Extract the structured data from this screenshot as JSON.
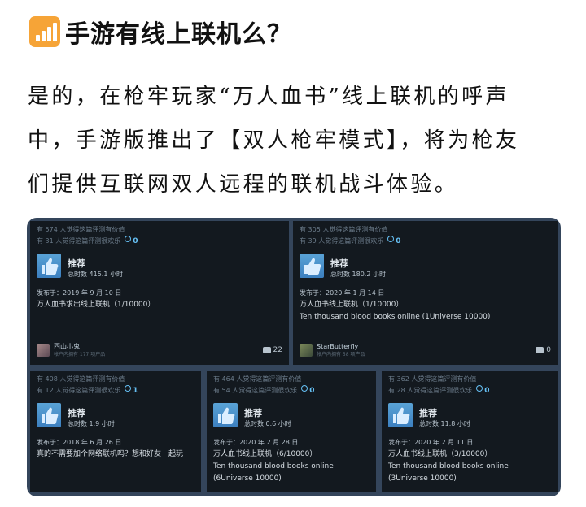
{
  "heading": "手游有线上联机么？",
  "paragraph": [
    "是的，在枪牢玩家“万人血书”线上联机的呼声",
    "中，手游版推出了【双人枪牢模式】，将为枪友",
    "们提供互联网双人远程的联机战斗体验。"
  ],
  "reviews": [
    {
      "helpful": "有 574 人觉得这篇评测有价值",
      "funny": "有 31 人觉得这篇评测很欢乐",
      "awards": "0",
      "recommend": "推荐",
      "hours": "总时数 415.1 小时",
      "posted": "发布于：2019 年 9 月 10 日",
      "body": [
        "万人血书求出线上联机（1/10000）"
      ],
      "author": "西山小鬼",
      "author_sub": "帐户内拥有 177 项产品",
      "comments": "22"
    },
    {
      "helpful": "有 305 人觉得这篇评测有价值",
      "funny": "有 39 人觉得这篇评测很欢乐",
      "awards": "0",
      "recommend": "推荐",
      "hours": "总时数 180.2 小时",
      "posted": "发布于：2020 年 1 月 14 日",
      "body": [
        "万人血书线上联机（1/10000）",
        "Ten thousand blood books online (1Universe 10000)"
      ],
      "author": "StarButterfly",
      "author_sub": "帐户内拥有 58 项产品",
      "comments": "0"
    },
    {
      "helpful": "有 408 人觉得这篇评测有价值",
      "funny": "有 12 人觉得这篇评测很欢乐",
      "awards": "1",
      "recommend": "推荐",
      "hours": "总时数 1.9 小时",
      "posted": "发布于：2018 年 6 月 26 日",
      "body": [
        "真的不需要加个网络联机吗？想和好友一起玩"
      ]
    },
    {
      "helpful": "有 464 人觉得这篇评测有价值",
      "funny": "有 54 人觉得这篇评测很欢乐",
      "awards": "0",
      "recommend": "推荐",
      "hours": "总时数 0.6 小时",
      "posted": "发布于：2020 年 2 月 28 日",
      "body": [
        "万人血书线上联机（6/10000）",
        "Ten thousand blood books online",
        "(6Universe 10000)"
      ]
    },
    {
      "helpful": "有 362 人觉得这篇评测有价值",
      "funny": "有 28 人觉得这篇评测很欢乐",
      "awards": "0",
      "recommend": "推荐",
      "hours": "总时数 11.8 小时",
      "posted": "发布于：2020 年 2 月 11 日",
      "body": [
        "万人血书线上联机（3/10000）",
        "Ten thousand blood books online",
        "(3Universe 10000)"
      ]
    }
  ]
}
